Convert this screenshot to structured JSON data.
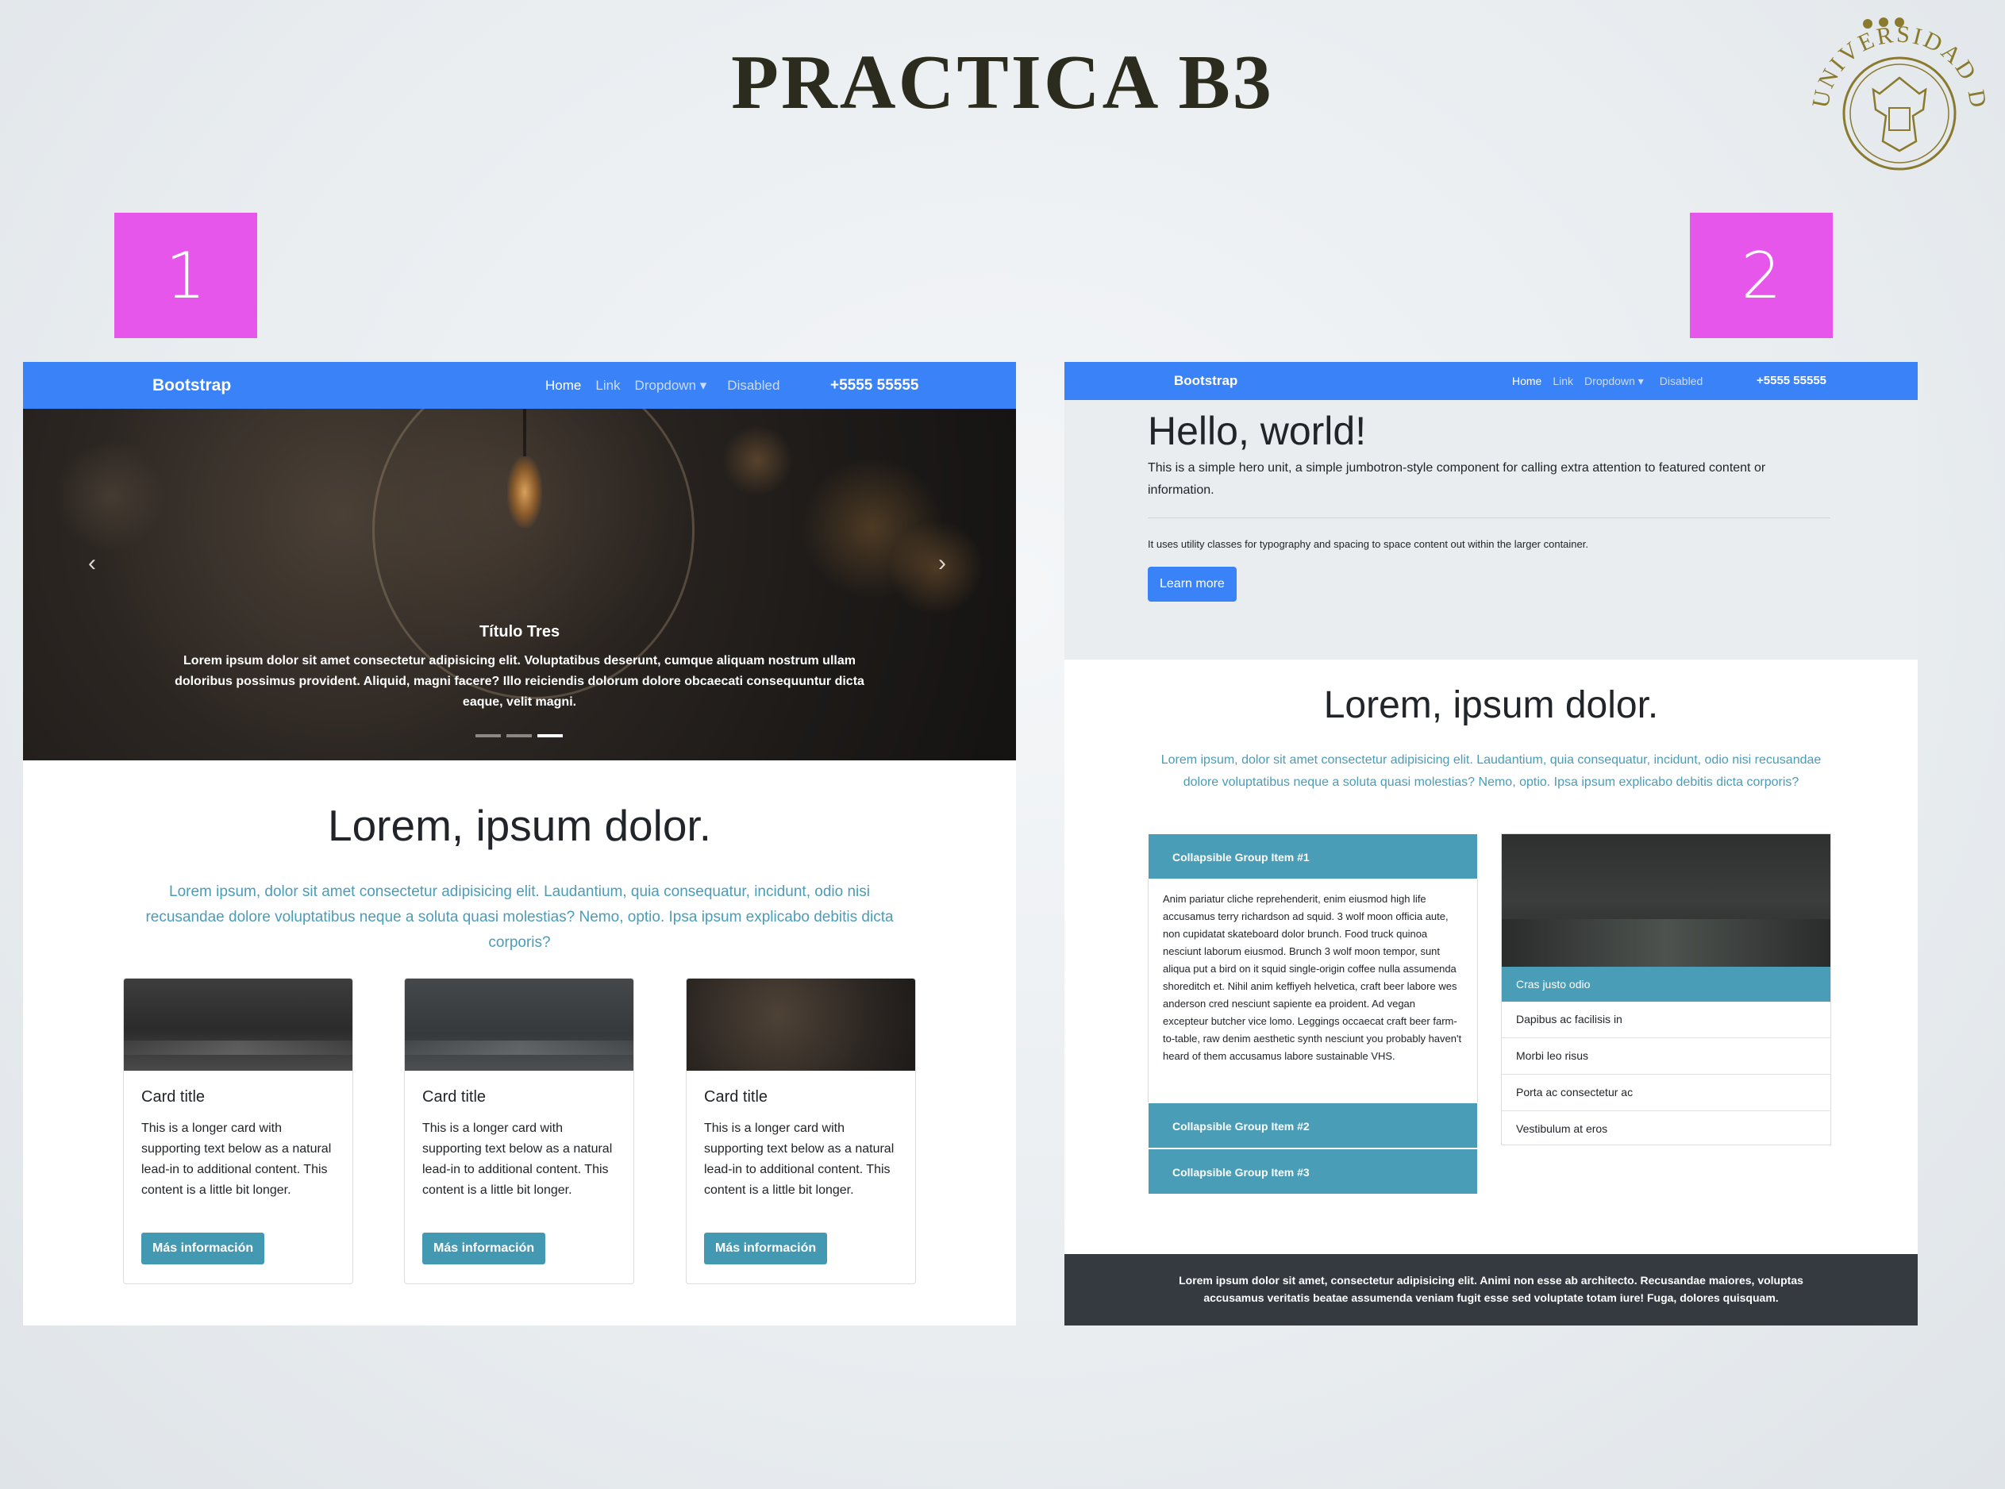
{
  "slide": {
    "title": "PRACTICA B3",
    "label_1": "1",
    "label_2": "2",
    "seal_text": "UNIVERSIDAD DE COLIMA"
  },
  "panel1": {
    "nav": {
      "brand": "Bootstrap",
      "links": [
        "Home",
        "Link",
        "Dropdown ▾",
        "Disabled"
      ],
      "phone": "+5555 55555"
    },
    "carousel": {
      "prev": "‹",
      "next": "›",
      "caption_title": "Título Tres",
      "caption_text": "Lorem ipsum dolor sit amet consectetur adipisicing elit. Voluptatibus deserunt, cumque aliquam nostrum ullam doloribus possimus provident. Aliquid, magni facere? Illo reiciendis dolorum dolore obcaecati consequuntur dicta eaque, velit magni."
    },
    "section": {
      "title": "Lorem, ipsum dolor.",
      "lead": "Lorem ipsum, dolor sit amet consectetur adipisicing elit. Laudantium, quia consequatur, incidunt, odio nisi recusandae dolore voluptatibus neque a soluta quasi molestias? Nemo, optio. Ipsa ipsum explicabo debitis dicta corporis?"
    },
    "cards": [
      {
        "title": "Card title",
        "text": "This is a longer card with supporting text below as a natural lead-in to additional content. This content is a little bit longer.",
        "button": "Más información"
      },
      {
        "title": "Card title",
        "text": "This is a longer card with supporting text below as a natural lead-in to additional content. This content is a little bit longer.",
        "button": "Más información"
      },
      {
        "title": "Card title",
        "text": "This is a longer card with supporting text below as a natural lead-in to additional content. This content is a little bit longer.",
        "button": "Más información"
      }
    ]
  },
  "panel2": {
    "nav": {
      "brand": "Bootstrap",
      "links": [
        "Home",
        "Link",
        "Dropdown ▾",
        "Disabled"
      ],
      "phone": "+5555 55555"
    },
    "jumbotron": {
      "title": "Hello, world!",
      "lead": "This is a simple hero unit, a simple jumbotron-style component for calling extra attention to featured content or information.",
      "text": "It uses utility classes for typography and spacing to space content out within the larger container.",
      "button": "Learn more"
    },
    "section": {
      "title": "Lorem, ipsum dolor.",
      "lead": "Lorem ipsum, dolor sit amet consectetur adipisicing elit. Laudantium, quia consequatur, incidunt, odio nisi recusandae dolore voluptatibus neque a soluta quasi molestias? Nemo, optio. Ipsa ipsum explicabo debitis dicta corporis?"
    },
    "accordion": {
      "item1": "Collapsible Group Item #1",
      "body": "Anim pariatur cliche reprehenderit, enim eiusmod high life accusamus terry richardson ad squid. 3 wolf moon officia aute, non cupidatat skateboard dolor brunch. Food truck quinoa nesciunt laborum eiusmod. Brunch 3 wolf moon tempor, sunt aliqua put a bird on it squid single-origin coffee nulla assumenda shoreditch et. Nihil anim keffiyeh helvetica, craft beer labore wes anderson cred nesciunt sapiente ea proident. Ad vegan excepteur butcher vice lomo. Leggings occaecat craft beer farm-to-table, raw denim aesthetic synth nesciunt you probably haven't heard of them accusamus labore sustainable VHS.",
      "item2": "Collapsible Group Item #2",
      "item3": "Collapsible Group Item #3"
    },
    "list_card": {
      "header": "Cras justo odio",
      "items": [
        "Dapibus ac facilisis in",
        "Morbi leo risus",
        "Porta ac consectetur ac",
        "Vestibulum at eros"
      ]
    },
    "footer": "Lorem ipsum dolor sit amet, consectetur adipisicing elit. Animi non esse ab architecto. Recusandae maiores, voluptas accusamus veritatis beatae assumenda veniam fugit esse sed voluptate totam iure! Fuga, dolores quisquam."
  },
  "colors": {
    "navbar": "#3a82f7",
    "label_box": "#e756ea",
    "accent_teal": "#4a9db6",
    "footer_dark": "#343a40"
  }
}
